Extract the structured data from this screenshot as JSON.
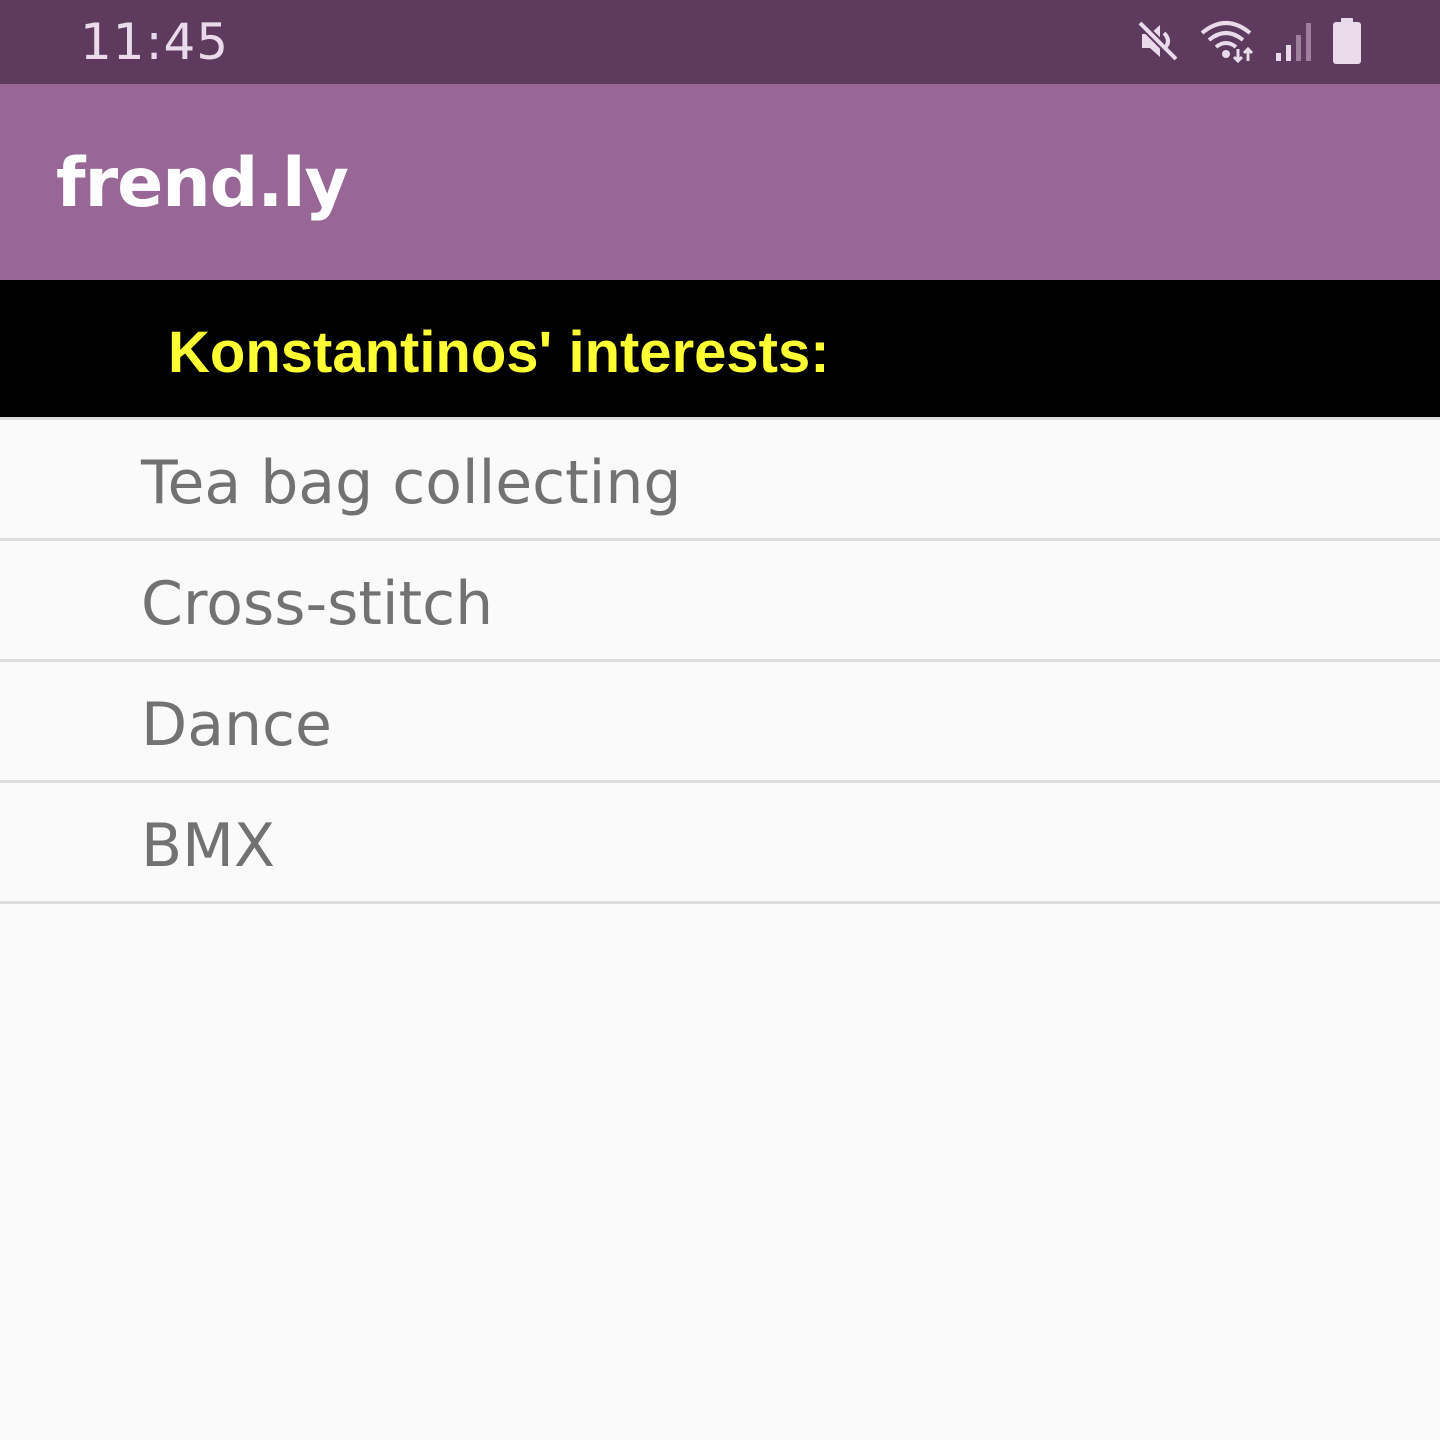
{
  "status_bar": {
    "time": "11:45",
    "icons": [
      "mute-icon",
      "wifi-icon",
      "signal-icon",
      "battery-icon"
    ]
  },
  "app_bar": {
    "title": "frend.ly"
  },
  "header": {
    "text": "Konstantinos' interests:"
  },
  "interests": [
    {
      "label": "Tea bag collecting"
    },
    {
      "label": "Cross-stitch"
    },
    {
      "label": "Dance"
    },
    {
      "label": "BMX"
    }
  ],
  "colors": {
    "status_bar": "#5e3b5e",
    "app_bar": "#986798",
    "header_band": "#000000",
    "header_text": "#ffff33",
    "list_text": "#727272",
    "divider": "#dcdcdc",
    "background": "#fafafa"
  }
}
